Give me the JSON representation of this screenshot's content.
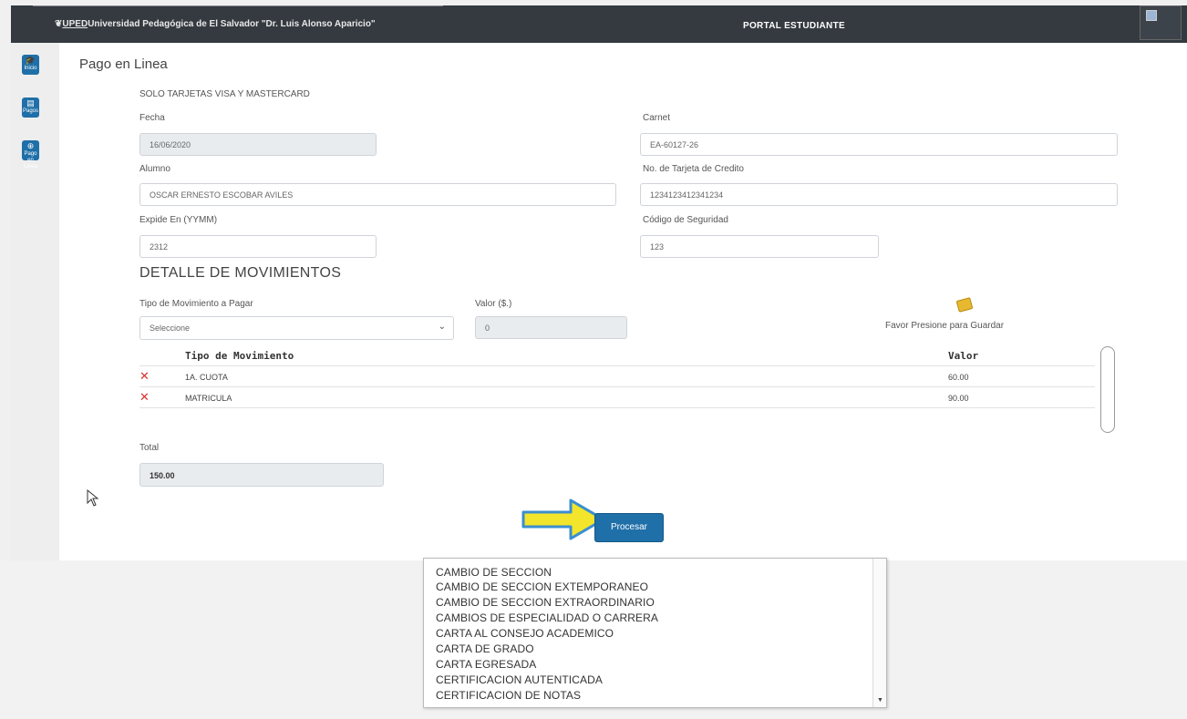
{
  "header": {
    "logo_text": "UPED",
    "university_name": "Universidad Pedagógica de El Salvador \"Dr. Luis Alonso Aparicio\"",
    "portal_title": "PORTAL ESTUDIANTE"
  },
  "sidebar": {
    "items": [
      {
        "label": "Inicio",
        "icon": "graduation-icon"
      },
      {
        "label": "Pagos",
        "icon": "payments-icon"
      },
      {
        "label": "Pago en Linea",
        "icon": "online-payment-icon"
      }
    ]
  },
  "page": {
    "title": "Pago en Linea",
    "subtitle": "SOLO TARJETAS VISA Y MASTERCARD"
  },
  "form": {
    "fecha_label": "Fecha",
    "fecha_value": "16/06/2020",
    "carnet_label": "Carnet",
    "carnet_value": "EA-60127-26",
    "alumno_label": "Alumno",
    "alumno_value": "OSCAR ERNESTO ESCOBAR AVILES",
    "tarjeta_label": "No. de Tarjeta de Credito",
    "tarjeta_value": "1234123412341234",
    "expide_label": "Expide En (YYMM)",
    "expide_value": "2312",
    "codigo_label": "Código de Seguridad",
    "codigo_value": "123"
  },
  "movimientos": {
    "section_title": "DETALLE DE MOVIMIENTOS",
    "tipo_label": "Tipo de Movimiento a Pagar",
    "tipo_selected": "Seleccione",
    "valor_label": "Valor ($.)",
    "valor_value": "0",
    "save_hint": "Favor Presione para Guardar",
    "table": {
      "headers": [
        "Tipo de Movimiento",
        "Valor"
      ],
      "rows": [
        {
          "tipo": "1A. CUOTA",
          "valor": "60.00"
        },
        {
          "tipo": "MATRICULA",
          "valor": "90.00"
        }
      ]
    }
  },
  "total": {
    "label": "Total",
    "value": "150.00"
  },
  "actions": {
    "process_label": "Procesar"
  },
  "dropdown_options": [
    "CAMBIO DE SECCION",
    "CAMBIO DE SECCION EXTEMPORANEO",
    "CAMBIO DE SECCION EXTRAORDINARIO",
    "CAMBIOS DE ESPECIALIDAD O CARRERA",
    "CARTA AL CONSEJO ACADEMICO",
    "CARTA DE GRADO",
    "CARTA EGRESADA",
    "CERTIFICACION AUTENTICADA",
    "CERTIFICACION DE NOTAS"
  ],
  "colors": {
    "header_bg": "#343a40",
    "primary": "#1f6fa8",
    "delete": "#d9312b",
    "arrow": "#f2e52b"
  }
}
